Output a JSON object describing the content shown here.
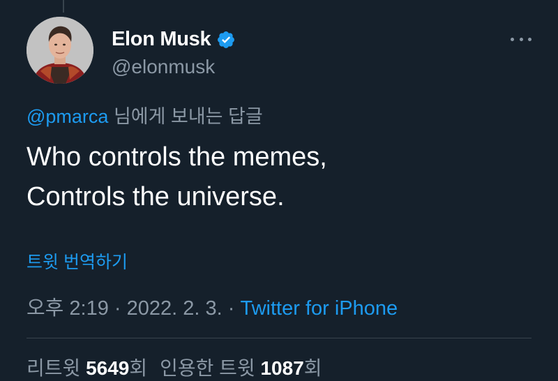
{
  "tweet": {
    "author": {
      "display_name": "Elon Musk",
      "handle": "@elonmusk",
      "verified": true,
      "avatar_icon": "profile-photo"
    },
    "reply_to": {
      "mention": "@pmarca",
      "suffix": " 님에게 보내는 답글"
    },
    "text_lines": [
      "Who controls the memes,",
      "Controls the universe."
    ],
    "translate_label": "트윗 번역하기",
    "timestamp": {
      "time": "오후 2:19",
      "separator": " · ",
      "date": "2022. 2. 3.",
      "source": "Twitter for iPhone"
    },
    "stats": {
      "retweets_label": "리트윗 ",
      "retweets_count": "5649",
      "retweets_unit": "회",
      "quotes_label": "인용한 트윗 ",
      "quotes_count": "1087",
      "quotes_unit": "회"
    }
  },
  "colors": {
    "background": "#15202b",
    "accent": "#1d9bf0",
    "secondary_text": "#8b98a5",
    "divider": "#38444d"
  }
}
